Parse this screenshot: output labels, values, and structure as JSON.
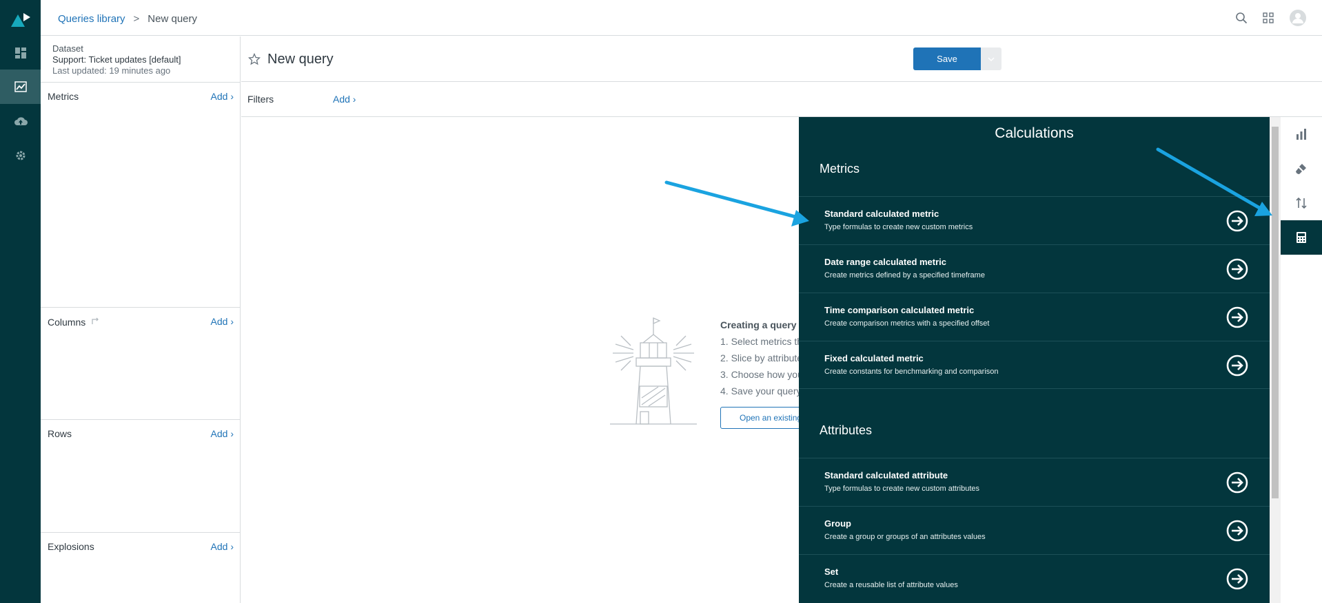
{
  "breadcrumb": {
    "link": "Queries library",
    "sep": ">",
    "current": "New query"
  },
  "dataset": {
    "label": "Dataset",
    "name": "Support: Ticket updates [default]",
    "updated": "Last updated: 19 minutes ago"
  },
  "sections": [
    {
      "title": "Metrics",
      "add": "Add ›"
    },
    {
      "title": "Columns",
      "add": "Add ›"
    },
    {
      "title": "Rows",
      "add": "Add ›"
    },
    {
      "title": "Explosions",
      "add": "Add ›"
    }
  ],
  "query": {
    "title": "New query",
    "save": "Save"
  },
  "filters": {
    "label": "Filters",
    "add": "Add ›"
  },
  "empty": {
    "heading": "Creating a query",
    "steps": [
      "1. Select metrics th",
      "2. Slice by attribute",
      "3. Choose how you",
      "4. Save your query"
    ],
    "button": "Open an existing"
  },
  "calculations": {
    "title": "Calculations",
    "metrics_title": "Metrics",
    "metrics": [
      {
        "name": "Standard calculated metric",
        "desc": "Type formulas to create new custom metrics"
      },
      {
        "name": "Date range calculated metric",
        "desc": "Create metrics defined by a specified timeframe"
      },
      {
        "name": "Time comparison calculated metric",
        "desc": "Create comparison metrics with a specified offset"
      },
      {
        "name": "Fixed calculated metric",
        "desc": "Create constants for benchmarking and comparison"
      }
    ],
    "attributes_title": "Attributes",
    "attributes": [
      {
        "name": "Standard calculated attribute",
        "desc": "Type formulas to create new custom attributes"
      },
      {
        "name": "Group",
        "desc": "Create a group or groups of an attributes values"
      },
      {
        "name": "Set",
        "desc": "Create a reusable list of attribute values"
      }
    ]
  },
  "icons": {
    "nav": [
      "dashboard-icon",
      "reporting-icon",
      "cloud-upload-icon",
      "gear-icon"
    ],
    "top": [
      "search-icon",
      "apps-grid-icon",
      "user-avatar-icon"
    ],
    "rail": [
      "chart-icon",
      "brush-icon",
      "sort-icon",
      "calculator-icon"
    ]
  },
  "colors": {
    "nav": "#03363d",
    "accent": "#1f73b7",
    "annotation": "#1aa3e0"
  }
}
